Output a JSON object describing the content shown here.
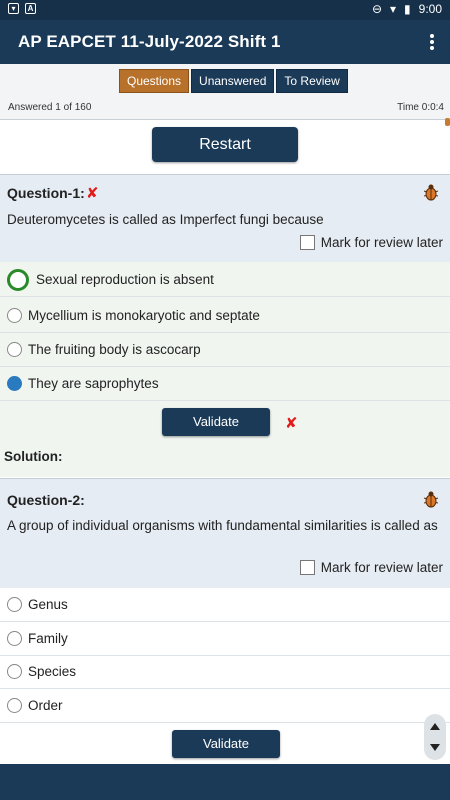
{
  "status_bar": {
    "time": "9:00",
    "icons": [
      "notification-icon",
      "notification-icon",
      "dnd-icon",
      "wifi-icon",
      "battery-icon"
    ]
  },
  "app_bar": {
    "title": "AP EAPCET 11-July-2022 Shift 1"
  },
  "tabs": [
    {
      "label": "Questions",
      "active": true
    },
    {
      "label": "Unanswered",
      "active": false
    },
    {
      "label": "To Review",
      "active": false
    }
  ],
  "progress": {
    "answered": "Answered 1 of 160",
    "time": "Time 0:0:4"
  },
  "restart_label": "Restart",
  "questions": [
    {
      "title": "Question-1:",
      "wrong_mark": "✘",
      "text": "Deuteromycetes is called as Imperfect fungi because",
      "review_label": "Mark for review later",
      "options": [
        {
          "label": "Sexual reproduction is absent",
          "state": "correct"
        },
        {
          "label": "Mycellium is monokaryotic and septate",
          "state": "none"
        },
        {
          "label": "The fruiting body is ascocarp",
          "state": "none"
        },
        {
          "label": "They are saprophytes",
          "state": "selected"
        }
      ],
      "validate_label": "Validate",
      "result_mark": "✘",
      "solution_label": "Solution:"
    },
    {
      "title": "Question-2:",
      "text": "A group of individual organisms with fundamental similarities is called as",
      "review_label": "Mark for review later",
      "options": [
        {
          "label": "Genus",
          "state": "none"
        },
        {
          "label": "Family",
          "state": "none"
        },
        {
          "label": "Species",
          "state": "none"
        },
        {
          "label": "Order",
          "state": "none"
        }
      ],
      "validate_label": "Validate"
    }
  ],
  "colors": {
    "primary": "#1b3a57",
    "active_tab": "#b8712a",
    "wrong": "#e21b1b",
    "correct": "#2a8a2a",
    "selected": "#2a7ac0"
  }
}
